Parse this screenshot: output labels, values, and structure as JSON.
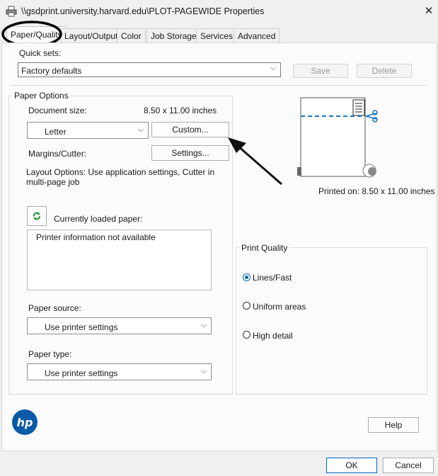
{
  "window": {
    "title": "\\\\gsdprint.university.harvard.edu\\PLOT-PAGEWIDE Properties",
    "close_glyph": "✕",
    "printer_icon": "printer-icon"
  },
  "tabs": [
    "Paper/Quality",
    "Layout/Output",
    "Color",
    "Job Storage",
    "Services",
    "Advanced"
  ],
  "quick_sets": {
    "label": "Quick sets:",
    "value": "Factory defaults",
    "save_label": "Save",
    "delete_label": "Delete"
  },
  "paper_options": {
    "group_label": "Paper Options",
    "document_size_label": "Document size:",
    "document_size_value": "8.50 x 11.00 inches",
    "size_select": "Letter",
    "custom_label": "Custom...",
    "margins_label": "Margins/Cutter:",
    "settings_label": "Settings...",
    "layout_options": "Layout Options: Use application settings, Cutter in multi-page job",
    "currently_loaded_label": "Currently loaded paper:",
    "printer_info": "Printer information not available",
    "paper_source_label": "Paper source:",
    "paper_source_value": "Use printer settings",
    "paper_type_label": "Paper type:",
    "paper_type_value": "Use printer settings"
  },
  "preview": {
    "printed_on": "Printed on: 8.50 x 11.00 inches"
  },
  "print_quality": {
    "group_label": "Print Quality",
    "options": [
      "Lines/Fast",
      "Uniform areas",
      "High detail"
    ],
    "selected": "Lines/Fast"
  },
  "footer": {
    "help_label": "Help",
    "ok_label": "OK",
    "cancel_label": "Cancel"
  },
  "colors": {
    "accent": "#0067c0",
    "hp_blue": "#0a5aa8",
    "preview_line": "#1a78c2"
  }
}
